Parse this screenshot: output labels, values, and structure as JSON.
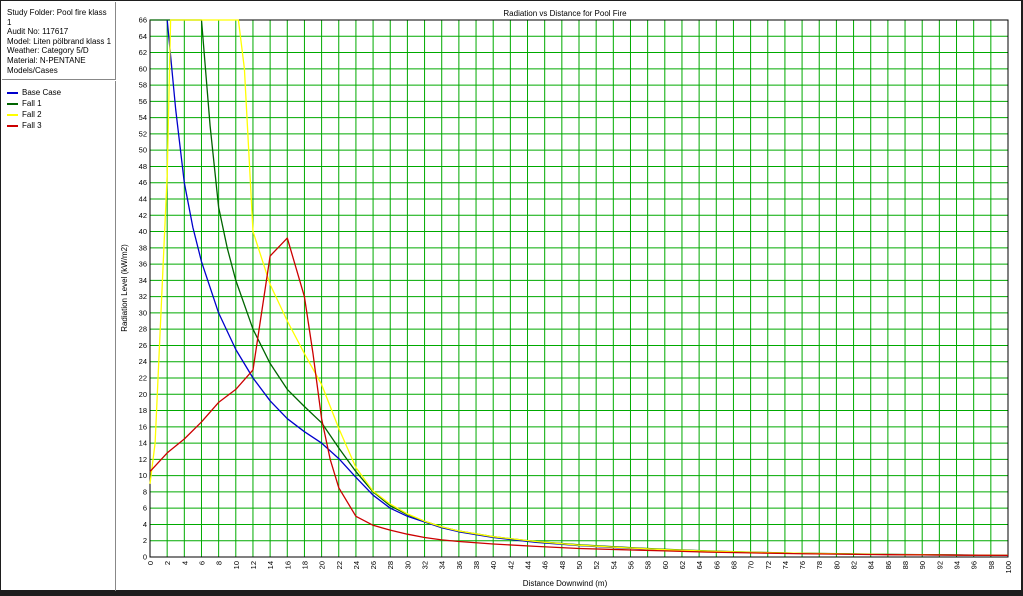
{
  "info": {
    "lines": [
      "Study Folder: Pool fire klass",
      "1",
      "Audit No: 117617",
      "Model: Liten pölbrand klass 1",
      "Weather: Category 5/D",
      "Material: N-PENTANE",
      "Models/Cases"
    ]
  },
  "legend": [
    {
      "name": "Base Case",
      "color": "#0000cc"
    },
    {
      "name": "Fall 1",
      "color": "#006400"
    },
    {
      "name": "Fall 2",
      "color": "#ffff00"
    },
    {
      "name": "Fall 3",
      "color": "#cc0000"
    }
  ],
  "chart_data": {
    "type": "line",
    "title": "Radiation vs Distance for Pool Fire",
    "xlabel": "Distance Downwind (m)",
    "ylabel": "Radiation Level (kW/m2)",
    "xlim": [
      0,
      100
    ],
    "ylim": [
      0,
      66
    ],
    "grid": true,
    "x_ticks": [
      "0",
      "2",
      "4",
      "6",
      "8",
      "10",
      "12",
      "14",
      "16",
      "18",
      "20",
      "22",
      "24",
      "26",
      "28",
      "30",
      "32",
      "34",
      "36",
      "38",
      "40",
      "42",
      "44",
      "46",
      "48",
      "50",
      "52",
      "54",
      "56",
      "58",
      "60",
      "62",
      "64",
      "66",
      "68",
      "70",
      "72",
      "74",
      "76",
      "78",
      "80",
      "82",
      "84",
      "86",
      "88",
      "90",
      "92",
      "94",
      "96",
      "98",
      "100"
    ],
    "y_ticks": [
      "0",
      "2",
      "4",
      "6",
      "8",
      "10",
      "12",
      "14",
      "16",
      "18",
      "20",
      "22",
      "24",
      "26",
      "28",
      "30",
      "32",
      "34",
      "36",
      "38",
      "40",
      "42",
      "44",
      "46",
      "48",
      "50",
      "52",
      "54",
      "56",
      "58",
      "60",
      "62",
      "64",
      "66"
    ],
    "series": [
      {
        "name": "Base Case",
        "color": "#0000cc",
        "points": [
          [
            2,
            66
          ],
          [
            3,
            55
          ],
          [
            4,
            46
          ],
          [
            5,
            40.5
          ],
          [
            6,
            36.3
          ],
          [
            8,
            30
          ],
          [
            10,
            25.5
          ],
          [
            12,
            22
          ],
          [
            14,
            19.2
          ],
          [
            16,
            17
          ],
          [
            18,
            15.4
          ],
          [
            20,
            14
          ],
          [
            22,
            12.1
          ],
          [
            24,
            9.8
          ],
          [
            26,
            7.6
          ],
          [
            28,
            6
          ],
          [
            30,
            5
          ],
          [
            32,
            4.3
          ],
          [
            34,
            3.6
          ],
          [
            36,
            3.1
          ],
          [
            40,
            2.4
          ],
          [
            45,
            1.8
          ],
          [
            50,
            1.4
          ],
          [
            55,
            1.1
          ],
          [
            60,
            0.9
          ],
          [
            65,
            0.7
          ],
          [
            70,
            0.55
          ],
          [
            75,
            0.45
          ],
          [
            80,
            0.38
          ],
          [
            85,
            0.32
          ],
          [
            90,
            0.27
          ],
          [
            95,
            0.23
          ],
          [
            100,
            0.2
          ]
        ]
      },
      {
        "name": "Fall 1",
        "color": "#006400",
        "points": [
          [
            0,
            66
          ],
          [
            6,
            66
          ],
          [
            7,
            53
          ],
          [
            8,
            43
          ],
          [
            9,
            38
          ],
          [
            10,
            34
          ],
          [
            12,
            28
          ],
          [
            14,
            23.8
          ],
          [
            16,
            20.6
          ],
          [
            18,
            18.5
          ],
          [
            20,
            16.5
          ],
          [
            22,
            13.4
          ],
          [
            24,
            10.5
          ],
          [
            26,
            8
          ],
          [
            28,
            6.3
          ],
          [
            30,
            5.2
          ],
          [
            32,
            4.4
          ],
          [
            34,
            3.7
          ],
          [
            36,
            3.2
          ],
          [
            40,
            2.5
          ],
          [
            45,
            1.9
          ],
          [
            50,
            1.5
          ],
          [
            55,
            1.2
          ],
          [
            60,
            0.95
          ],
          [
            65,
            0.75
          ],
          [
            70,
            0.6
          ],
          [
            75,
            0.48
          ],
          [
            80,
            0.4
          ],
          [
            85,
            0.33
          ],
          [
            90,
            0.28
          ],
          [
            95,
            0.24
          ],
          [
            100,
            0.2
          ]
        ]
      },
      {
        "name": "Fall 2",
        "color": "#ffff00",
        "points": [
          [
            0,
            9
          ],
          [
            0.6,
            14
          ],
          [
            2,
            47
          ],
          [
            2.4,
            66
          ],
          [
            10.3,
            66
          ],
          [
            11,
            60
          ],
          [
            12,
            40
          ],
          [
            14,
            33.5
          ],
          [
            16,
            29
          ],
          [
            18,
            25
          ],
          [
            20,
            21.2
          ],
          [
            22,
            15.8
          ],
          [
            24,
            11
          ],
          [
            26,
            8.1
          ],
          [
            28,
            6.5
          ],
          [
            30,
            5.3
          ],
          [
            32,
            4.4
          ],
          [
            34,
            3.7
          ],
          [
            36,
            3.2
          ],
          [
            40,
            2.5
          ],
          [
            45,
            1.9
          ],
          [
            50,
            1.45
          ],
          [
            55,
            1.15
          ],
          [
            60,
            0.9
          ],
          [
            65,
            0.72
          ],
          [
            70,
            0.58
          ],
          [
            75,
            0.47
          ],
          [
            80,
            0.39
          ],
          [
            85,
            0.32
          ],
          [
            90,
            0.27
          ],
          [
            95,
            0.23
          ],
          [
            100,
            0.2
          ]
        ]
      },
      {
        "name": "Fall 3",
        "color": "#cc0000",
        "points": [
          [
            0,
            10.5
          ],
          [
            2,
            12.8
          ],
          [
            4,
            14.5
          ],
          [
            6,
            16.6
          ],
          [
            8,
            19
          ],
          [
            10,
            20.6
          ],
          [
            12,
            23
          ],
          [
            14,
            37
          ],
          [
            16,
            39.2
          ],
          [
            18,
            32
          ],
          [
            19,
            25
          ],
          [
            20,
            17
          ],
          [
            21,
            12
          ],
          [
            22,
            8.5
          ],
          [
            24,
            5
          ],
          [
            26,
            3.9
          ],
          [
            28,
            3.3
          ],
          [
            30,
            2.8
          ],
          [
            32,
            2.4
          ],
          [
            34,
            2.1
          ],
          [
            36,
            1.9
          ],
          [
            40,
            1.6
          ],
          [
            45,
            1.3
          ],
          [
            50,
            1.05
          ],
          [
            55,
            0.9
          ],
          [
            60,
            0.75
          ],
          [
            65,
            0.6
          ],
          [
            70,
            0.5
          ],
          [
            75,
            0.42
          ],
          [
            80,
            0.36
          ],
          [
            85,
            0.3
          ],
          [
            90,
            0.26
          ],
          [
            95,
            0.22
          ],
          [
            100,
            0.2
          ]
        ]
      }
    ]
  }
}
